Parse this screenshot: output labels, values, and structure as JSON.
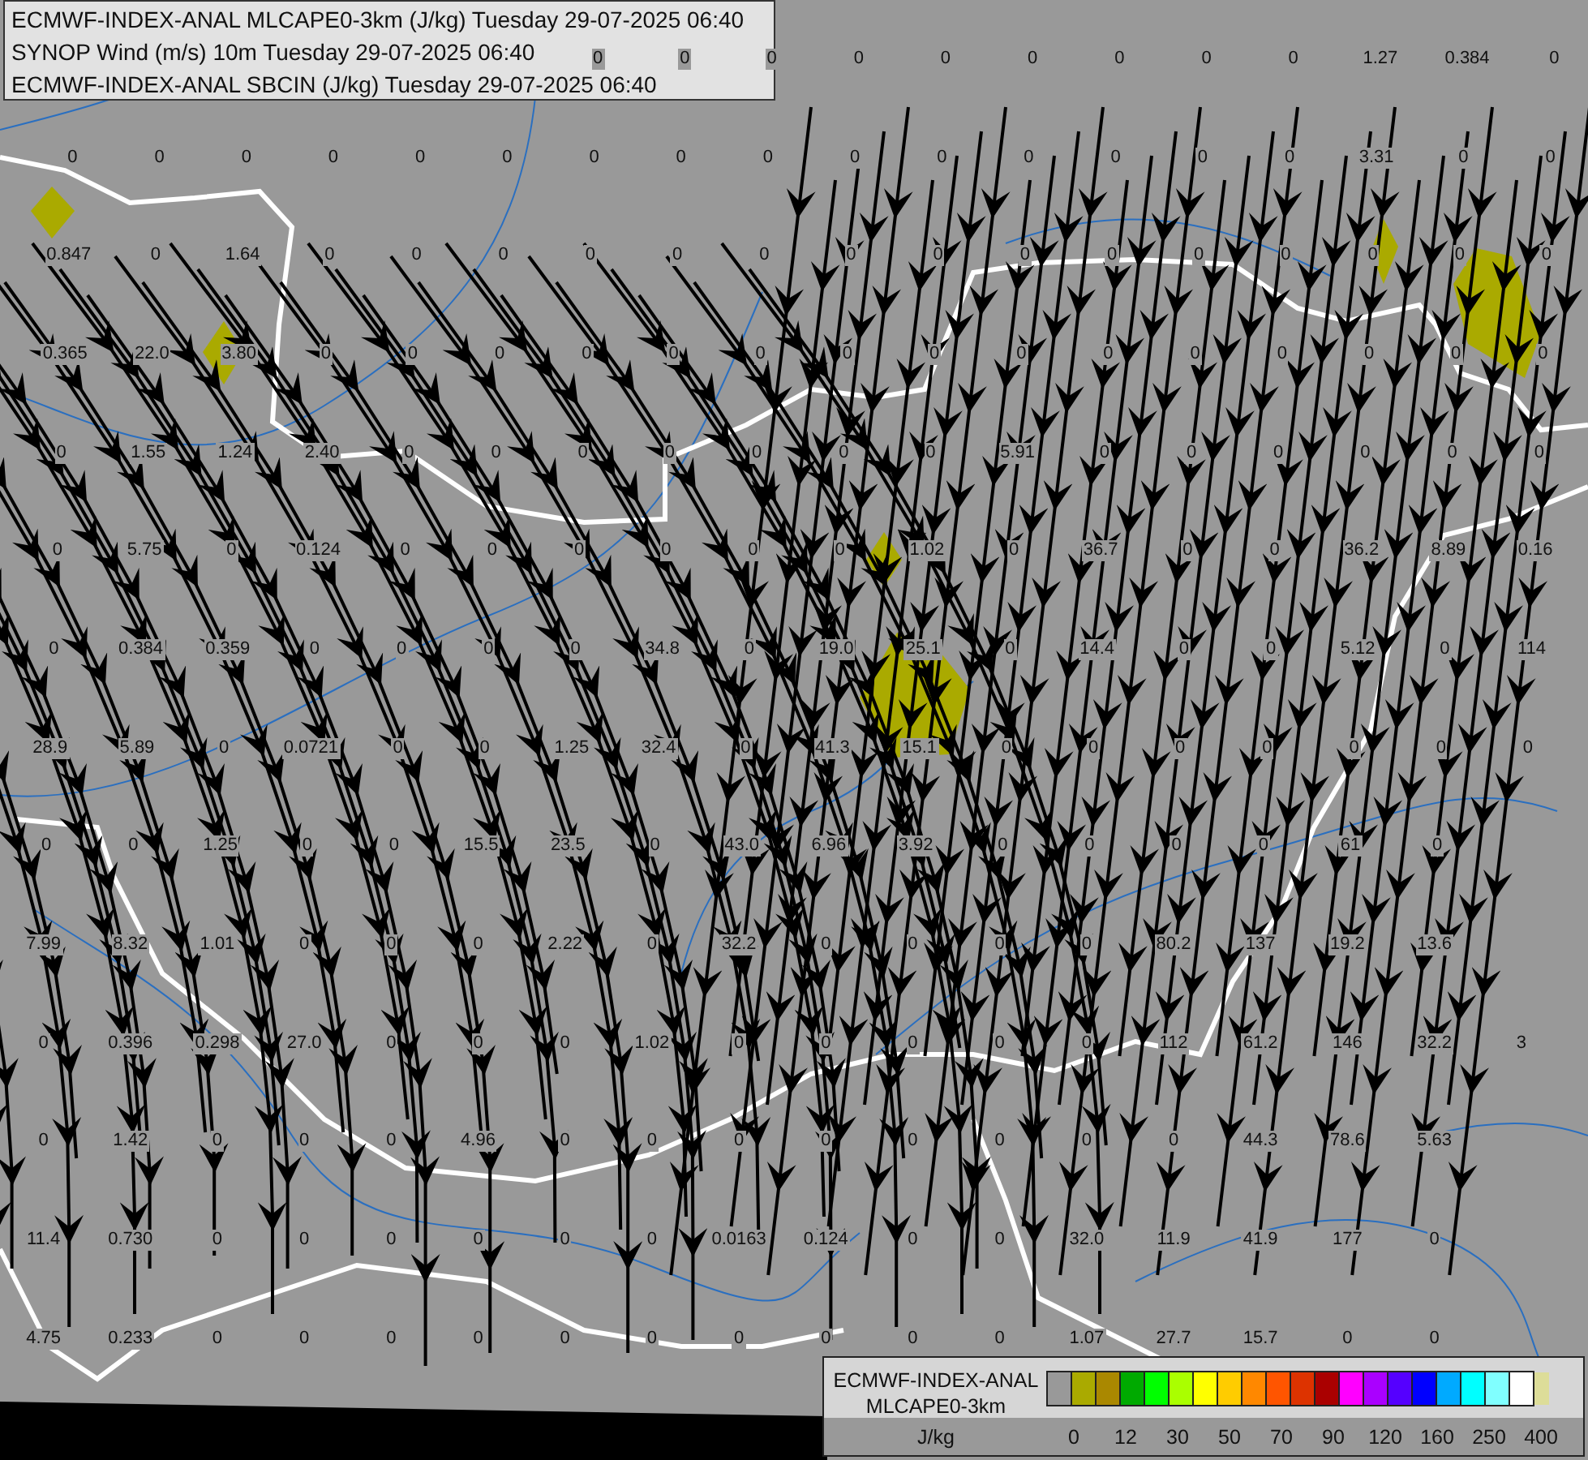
{
  "legend": {
    "lines": [
      "ECMWF-INDEX-ANAL MLCAPE0-3km (J/kg) Tuesday 29-07-2025 06:40",
      "SYNOP Wind (m/s) 10m Tuesday 29-07-2025 06:40",
      "ECMWF-INDEX-ANAL SBCIN (J/kg) Tuesday 29-07-2025 06:40"
    ]
  },
  "top_row_values": [
    "0",
    "0",
    "0",
    "0",
    "0",
    "0",
    "0",
    "0",
    "0",
    "1.27",
    "0.384",
    "0"
  ],
  "value_grid": [
    [
      "0",
      "0",
      "0",
      "0",
      "0",
      "0",
      "0",
      "0",
      "0",
      "0",
      "0",
      "0",
      "0",
      "0",
      "0",
      "3.31",
      "0",
      "0"
    ],
    [
      "0.847",
      "0",
      "1.64",
      "0",
      "0",
      "0",
      "0",
      "0",
      "0",
      "0",
      "0",
      "0",
      "0",
      "0",
      "0",
      "0",
      "0",
      "0"
    ],
    [
      "0.365",
      "22.0",
      "3.80",
      "0",
      "0",
      "0",
      "0",
      "0",
      "0",
      "0",
      "0",
      "0",
      "0",
      "0",
      "0",
      "0",
      "0",
      "0"
    ],
    [
      "0",
      "1.55",
      "1.24",
      "2.40",
      "0",
      "0",
      "0",
      "0",
      "0",
      "0",
      "0",
      "5.91",
      "0",
      "0",
      "0",
      "0",
      "0",
      "0"
    ],
    [
      "0",
      "5.75",
      "0",
      "0.124",
      "0",
      "0",
      "0",
      "0",
      "0",
      "0",
      "1.02",
      "0",
      "36.7",
      "0",
      "0",
      "36.2",
      "8.89",
      "0.16"
    ],
    [
      "0",
      "0.384",
      "0.359",
      "0",
      "0",
      "0",
      "0",
      "34.8",
      "0",
      "19.0",
      "25.1",
      "0",
      "14.4",
      "0",
      "0",
      "5.12",
      "0",
      "114"
    ],
    [
      "28.9",
      "5.89",
      "0",
      "0.0721",
      "0",
      "0",
      "1.25",
      "32.4",
      "0",
      "41.3",
      "15.1",
      "0",
      "0",
      "0",
      "0",
      "0",
      "0",
      "0"
    ],
    [
      "0",
      "0",
      "1.25",
      "0",
      "0",
      "15.5",
      "23.5",
      "0",
      "43.0",
      "6.96",
      "3.92",
      "0",
      "0",
      "0",
      "0",
      "61",
      "0"
    ],
    [
      "7.99",
      "8.32",
      "1.01",
      "0",
      "0",
      "0",
      "2.22",
      "0",
      "32.2",
      "0",
      "0",
      "0",
      "0",
      "80.2",
      "137",
      "19.2",
      "13.6"
    ],
    [
      "0",
      "0.396",
      "0.298",
      "27.0",
      "0",
      "0",
      "0",
      "1.02",
      "0",
      "0",
      "0",
      "0",
      "0",
      "112",
      "61.2",
      "146",
      "32.2",
      "3"
    ],
    [
      "0",
      "1.42",
      "0",
      "0",
      "0",
      "4.96",
      "0",
      "0",
      "0",
      "0",
      "0",
      "0",
      "0",
      "0",
      "44.3",
      "78.6",
      "5.63"
    ],
    [
      "11.4",
      "0.730",
      "0",
      "0",
      "0",
      "0",
      "0",
      "0",
      "0.0163",
      "0.124",
      "0",
      "0",
      "32.0",
      "11.9",
      "41.9",
      "177",
      "0"
    ],
    [
      "4.75",
      "0.233",
      "0",
      "0",
      "0",
      "0",
      "0",
      "0",
      "0",
      "0",
      "0",
      "0",
      "1.07",
      "27.7",
      "15.7",
      "0",
      "0"
    ]
  ],
  "colorbar": {
    "title_lines": [
      "ECMWF-INDEX-ANAL",
      "MLCAPE0-3km"
    ],
    "unit": "J/kg",
    "swatches": [
      {
        "color": "#999999"
      },
      {
        "color": "#aaaa00"
      },
      {
        "color": "#aa8800"
      },
      {
        "color": "#00aa00"
      },
      {
        "color": "#00ff00"
      },
      {
        "color": "#aaff00"
      },
      {
        "color": "#ffff00"
      },
      {
        "color": "#ffcc00"
      },
      {
        "color": "#ff8800"
      },
      {
        "color": "#ff5500"
      },
      {
        "color": "#dd3300"
      },
      {
        "color": "#aa0000"
      },
      {
        "color": "#ff00ff"
      },
      {
        "color": "#aa00ff"
      },
      {
        "color": "#5500ff"
      },
      {
        "color": "#0000ff"
      },
      {
        "color": "#00aaff"
      },
      {
        "color": "#00ffff"
      },
      {
        "color": "#80ffff"
      },
      {
        "color": "#ffffff"
      }
    ],
    "ticks": [
      "0",
      "12",
      "30",
      "50",
      "70",
      "90",
      "120",
      "160",
      "250",
      "400"
    ]
  }
}
